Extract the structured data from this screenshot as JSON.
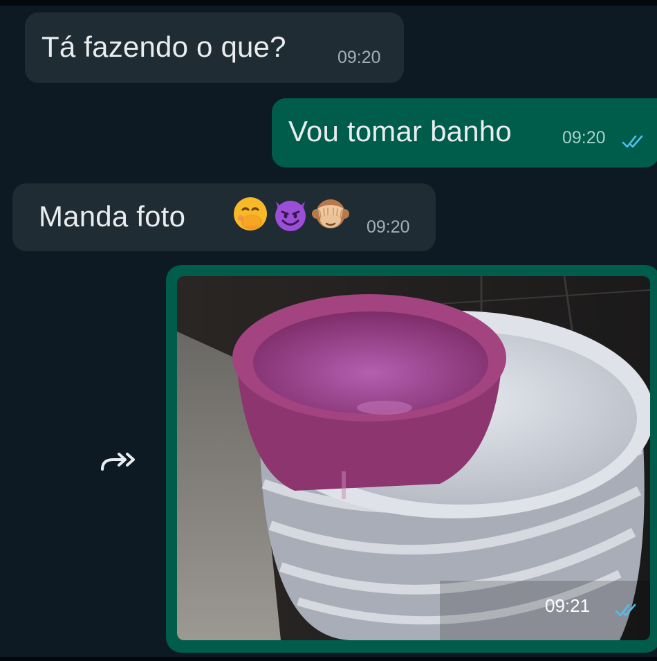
{
  "chat": {
    "messages": [
      {
        "direction": "incoming",
        "text": "Tá fazendo o que?",
        "time": "09:20"
      },
      {
        "direction": "outgoing",
        "text": "Vou tomar banho",
        "time": "09:20",
        "status": "read"
      },
      {
        "direction": "incoming",
        "text": "Manda foto",
        "emojis": [
          "hand-over-mouth-emoji",
          "smiling-devil-emoji",
          "see-no-evil-monkey-emoji"
        ],
        "time": "09:20"
      },
      {
        "direction": "outgoing",
        "type": "image",
        "image_subject": "purple-basin-on-white-buckets",
        "time": "09:21",
        "status": "read"
      }
    ],
    "forward_icon": "forward-arrow-icon"
  },
  "colors": {
    "background": "#0d1a24",
    "incoming_bubble": "#1f2c34",
    "outgoing_bubble": "#005c4b",
    "read_ticks": "#53bdeb"
  }
}
